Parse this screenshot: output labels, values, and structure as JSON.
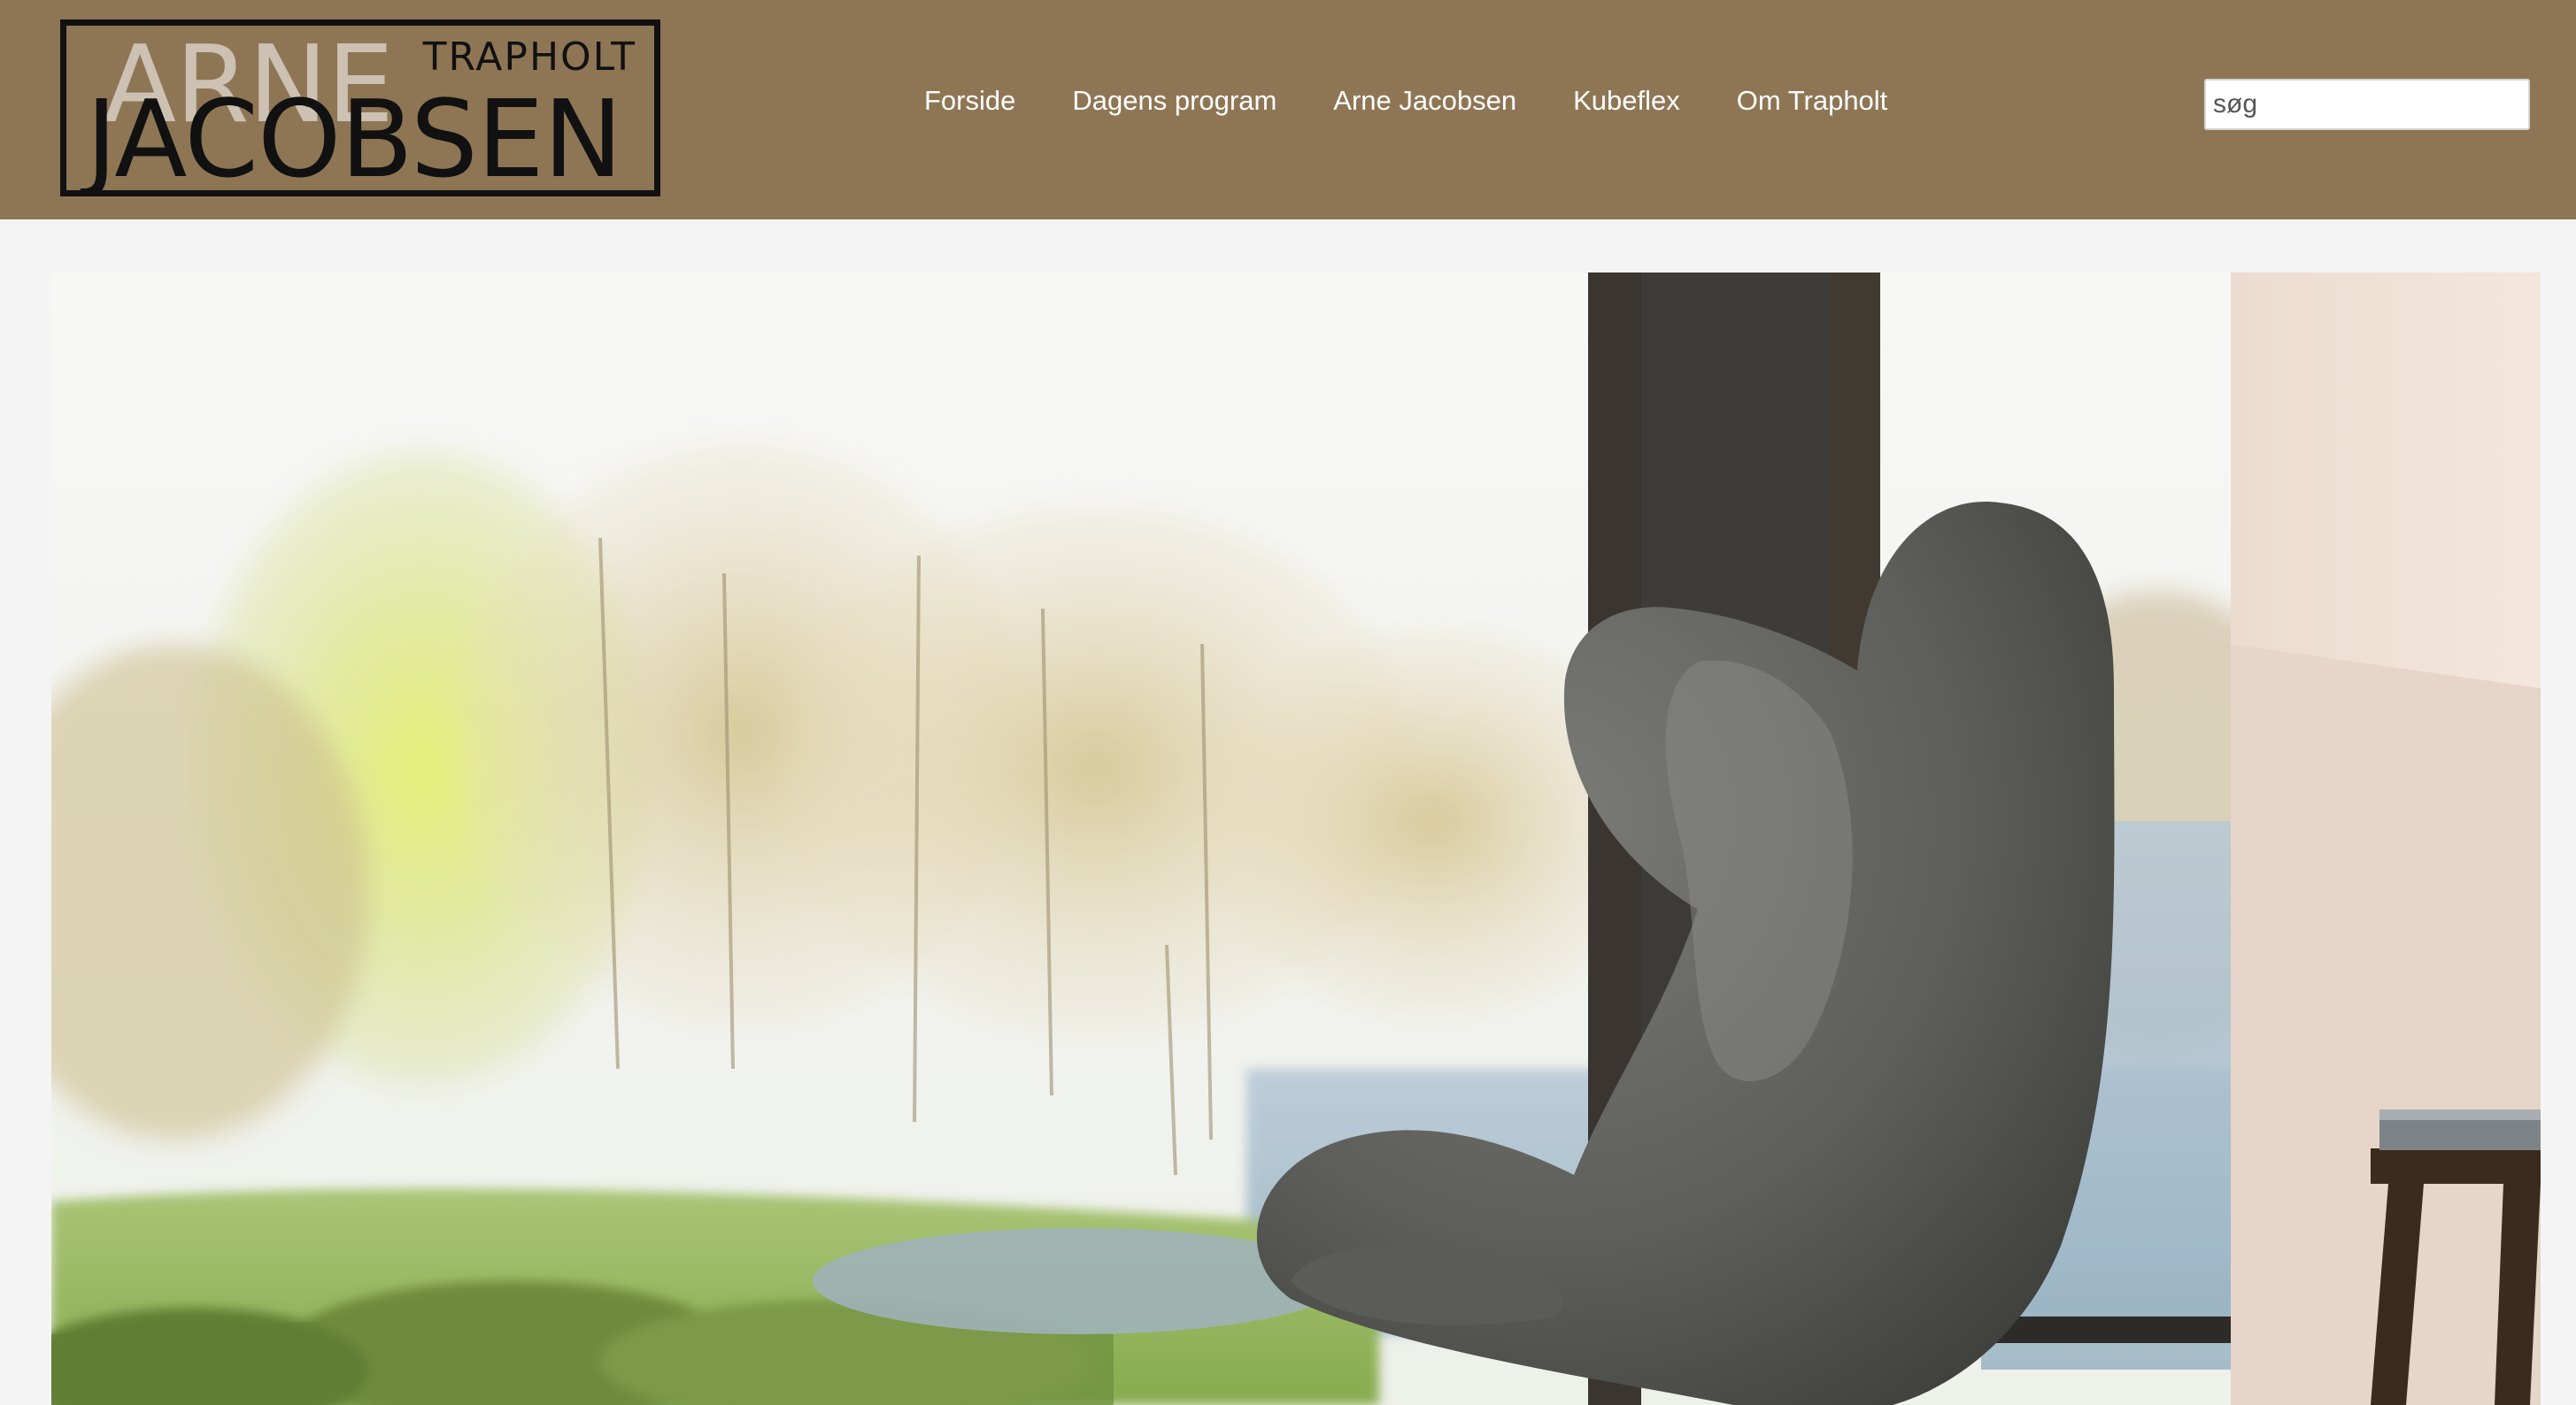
{
  "brand": {
    "logo_top_left": "ARNE",
    "logo_top_right": "TRAPHOLT",
    "logo_bottom": "JACOBSEN"
  },
  "nav": {
    "items": [
      {
        "label": "Forside"
      },
      {
        "label": "Dagens program"
      },
      {
        "label": "Arne Jacobsen"
      },
      {
        "label": "Kubeflex"
      },
      {
        "label": "Om Trapholt"
      }
    ]
  },
  "search": {
    "placeholder": "søg",
    "value": ""
  },
  "colors": {
    "header_bg": "#8e7655",
    "page_bg": "#f4f4f4",
    "nav_text": "#ffffff"
  },
  "hero": {
    "icon": "egg-chair-photo"
  }
}
